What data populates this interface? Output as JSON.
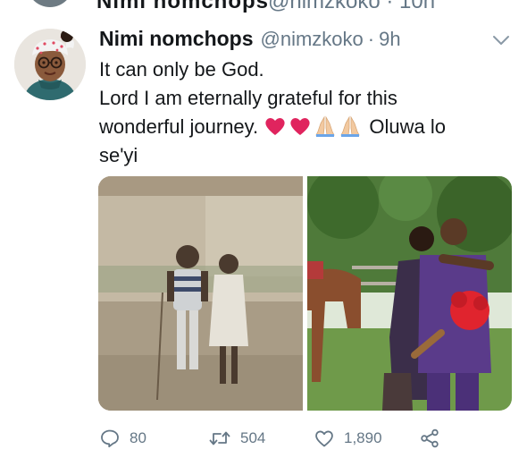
{
  "previous_tweet": {
    "name_partial": "Nimi nomchops",
    "meta_partial": "@nimzkoko · 10h"
  },
  "tweet": {
    "author": {
      "name": "Nimi nomchops",
      "handle": "@nimzkoko",
      "separator": "·",
      "time": "9h"
    },
    "text": {
      "line1": "It can only be God.",
      "line2": "Lord I am eternally grateful for this",
      "line3_start": "wonderful journey.",
      "line3_end": "Oluwa lo",
      "line4": "se'yi",
      "emojis": [
        "red-heart",
        "red-heart",
        "folded-hands",
        "folded-hands"
      ]
    },
    "media": [
      {
        "kind": "photo",
        "subject": "vintage-childhood-photo"
      },
      {
        "kind": "photo",
        "subject": "couple-with-horse-photo"
      }
    ],
    "actions": {
      "replies": "80",
      "retweets": "504",
      "likes": "1,890"
    }
  },
  "colors": {
    "text_primary": "#14171a",
    "text_secondary": "#657786",
    "heart_red": "#e0245e",
    "thread_line": "#b4c4cf"
  }
}
